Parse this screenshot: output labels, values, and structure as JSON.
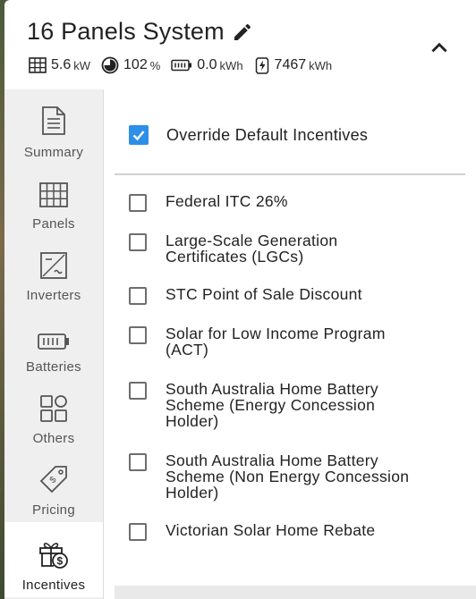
{
  "header": {
    "title": "16 Panels System",
    "stats": {
      "power_value": "5.6",
      "power_unit": "kW",
      "offset_value": "102",
      "offset_unit": "%",
      "battery_value": "0.0",
      "battery_unit": "kWh",
      "energy_value": "7467",
      "energy_unit": "kWh"
    }
  },
  "sidebar": {
    "items": [
      {
        "label": "Summary",
        "icon": "document-icon"
      },
      {
        "label": "Panels",
        "icon": "grid-icon"
      },
      {
        "label": "Inverters",
        "icon": "inverter-icon"
      },
      {
        "label": "Batteries",
        "icon": "battery-icon"
      },
      {
        "label": "Others",
        "icon": "squares-icon"
      },
      {
        "label": "Pricing",
        "icon": "tag-icon"
      },
      {
        "label": "Incentives",
        "icon": "gift-dollar-icon"
      }
    ],
    "active": "Incentives"
  },
  "incentives": {
    "override": {
      "label": "Override Default Incentives",
      "checked": true
    },
    "items": [
      {
        "label": "Federal ITC 26%",
        "checked": false
      },
      {
        "label": "Large-Scale Generation Certificates (LGCs)",
        "checked": false
      },
      {
        "label": "STC Point of Sale Discount",
        "checked": false
      },
      {
        "label": "Solar for Low Income Program (ACT)",
        "checked": false
      },
      {
        "label": "South Australia Home Battery Scheme (Energy Concession Holder)",
        "checked": false
      },
      {
        "label": "South Australia Home Battery Scheme (Non Energy Concession Holder)",
        "checked": false
      },
      {
        "label": "Victorian Solar Home Rebate",
        "checked": false
      }
    ]
  },
  "colors": {
    "accent": "#2d8fe8",
    "sidebar_bg": "#efefef"
  }
}
